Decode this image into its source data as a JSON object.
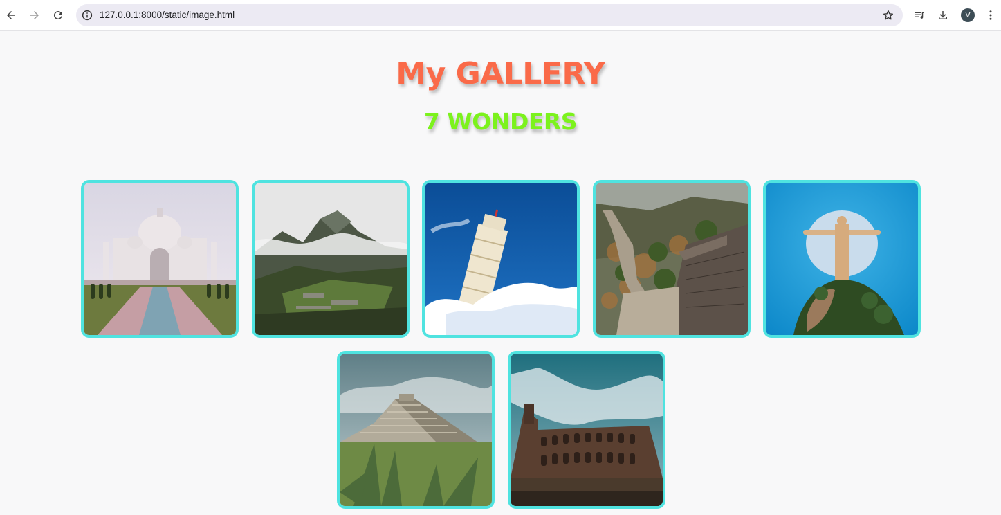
{
  "browser": {
    "url": "127.0.0.1:8000/static/image.html",
    "profile_initial": "V",
    "icons": [
      "back-arrow-icon",
      "forward-arrow-icon",
      "reload-icon",
      "site-info-icon",
      "bookmark-star-icon",
      "media-queue-icon",
      "download-icon",
      "menu-dots-icon"
    ]
  },
  "page": {
    "title": "My GALLERY",
    "subtitle": "7 WONDERS",
    "title_color": "#fa6a49",
    "subtitle_color": "#7cf21d",
    "frame_color": "#4fe3e0"
  },
  "gallery": [
    {
      "subject": "taj-mahal"
    },
    {
      "subject": "machu-picchu"
    },
    {
      "subject": "leaning-tower-of-pisa"
    },
    {
      "subject": "great-wall-of-china"
    },
    {
      "subject": "christ-the-redeemer"
    },
    {
      "subject": "chichen-itza"
    },
    {
      "subject": "colosseum"
    }
  ]
}
